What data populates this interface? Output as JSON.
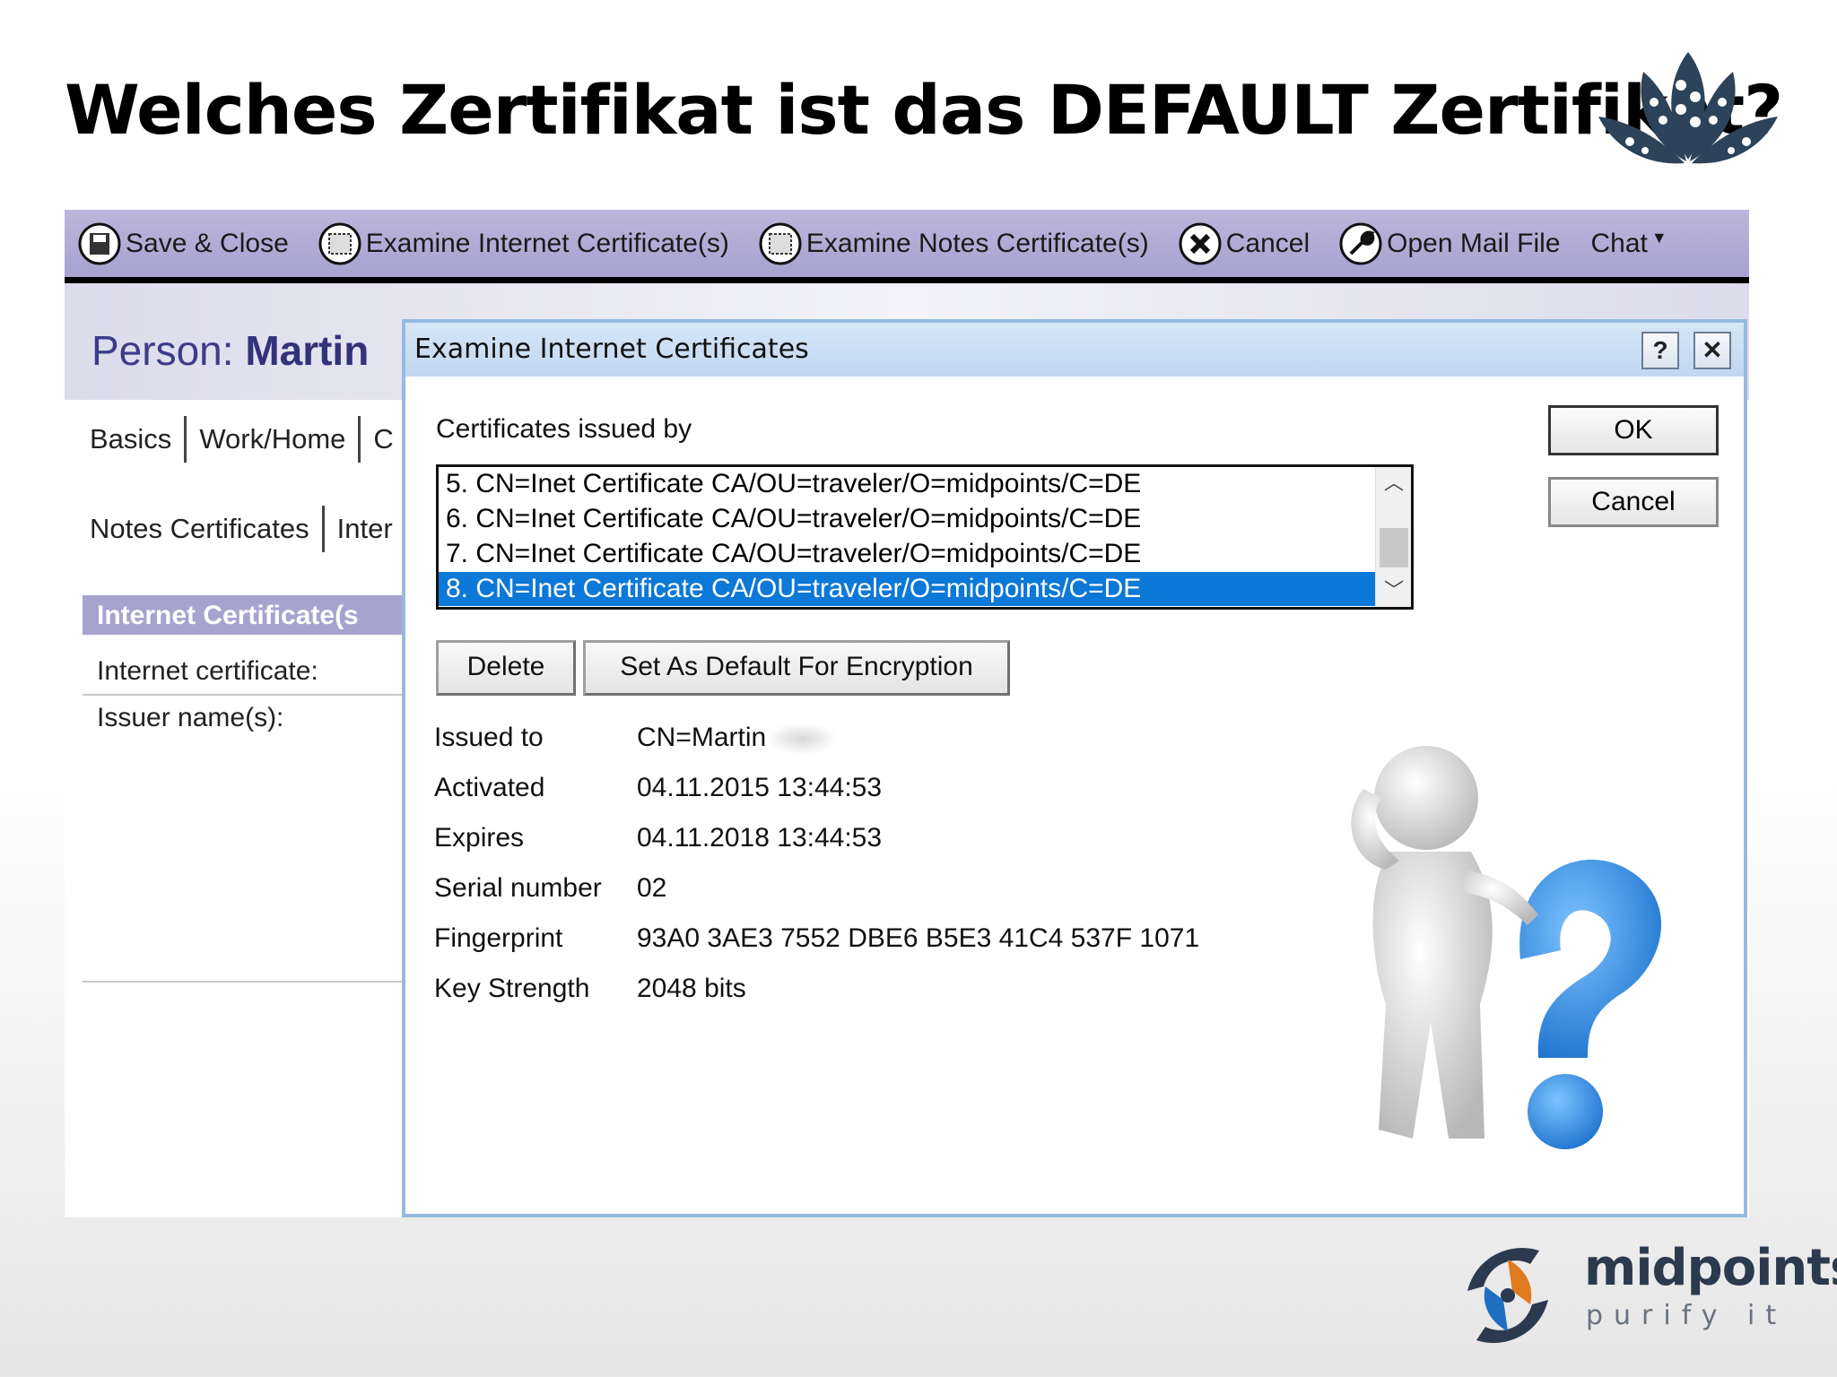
{
  "slide": {
    "title": "Welches Zertifikat ist das DEFAULT Zertifikat?"
  },
  "toolbar": {
    "save_close": "Save & Close",
    "examine_internet": "Examine Internet Certificate(s)",
    "examine_notes": "Examine Notes Certificate(s)",
    "cancel": "Cancel",
    "open_mail": "Open Mail File",
    "chat": "Chat"
  },
  "person": {
    "prefix": "Person:",
    "name": "Martin"
  },
  "tabs": {
    "basics": "Basics",
    "work_home": "Work/Home",
    "more": "C",
    "notes_certs": "Notes Certificates",
    "inter": "Inter"
  },
  "section": {
    "title": "Internet Certificate(s",
    "internet_certificate": "Internet certificate:",
    "issuer_names": "Issuer name(s):"
  },
  "dialog": {
    "title": "Examine Internet Certificates",
    "help": "?",
    "close": "✕",
    "issued_by_label": "Certificates issued by",
    "certificates": [
      "5. CN=Inet Certificate CA/OU=traveler/O=midpoints/C=DE",
      "6. CN=Inet Certificate CA/OU=traveler/O=midpoints/C=DE",
      "7. CN=Inet Certificate CA/OU=traveler/O=midpoints/C=DE",
      "8. CN=Inet Certificate CA/OU=traveler/O=midpoints/C=DE"
    ],
    "selected_index": 3,
    "ok": "OK",
    "cancel": "Cancel",
    "delete": "Delete",
    "set_default": "Set As Default For Encryption",
    "details": {
      "issued_to_label": "Issued to",
      "issued_to": "CN=Martin",
      "activated_label": "Activated",
      "activated": "04.11.2015 13:44:53",
      "expires_label": "Expires",
      "expires": "04.11.2018 13:44:53",
      "serial_label": "Serial number",
      "serial": "02",
      "fingerprint_label": "Fingerprint",
      "fingerprint": "93A0 3AE3 7552 DBE6 B5E3 41C4 537F 1071",
      "key_strength_label": "Key Strength",
      "key_strength": "2048 bits"
    }
  },
  "brand": {
    "name": "midpoints",
    "tagline": "purify it"
  },
  "colors": {
    "toolbar": "#a7a2cf",
    "selection": "#0c78d7",
    "dialog_title": "#c1d7f0",
    "question_mark": "#3a8fe0"
  }
}
